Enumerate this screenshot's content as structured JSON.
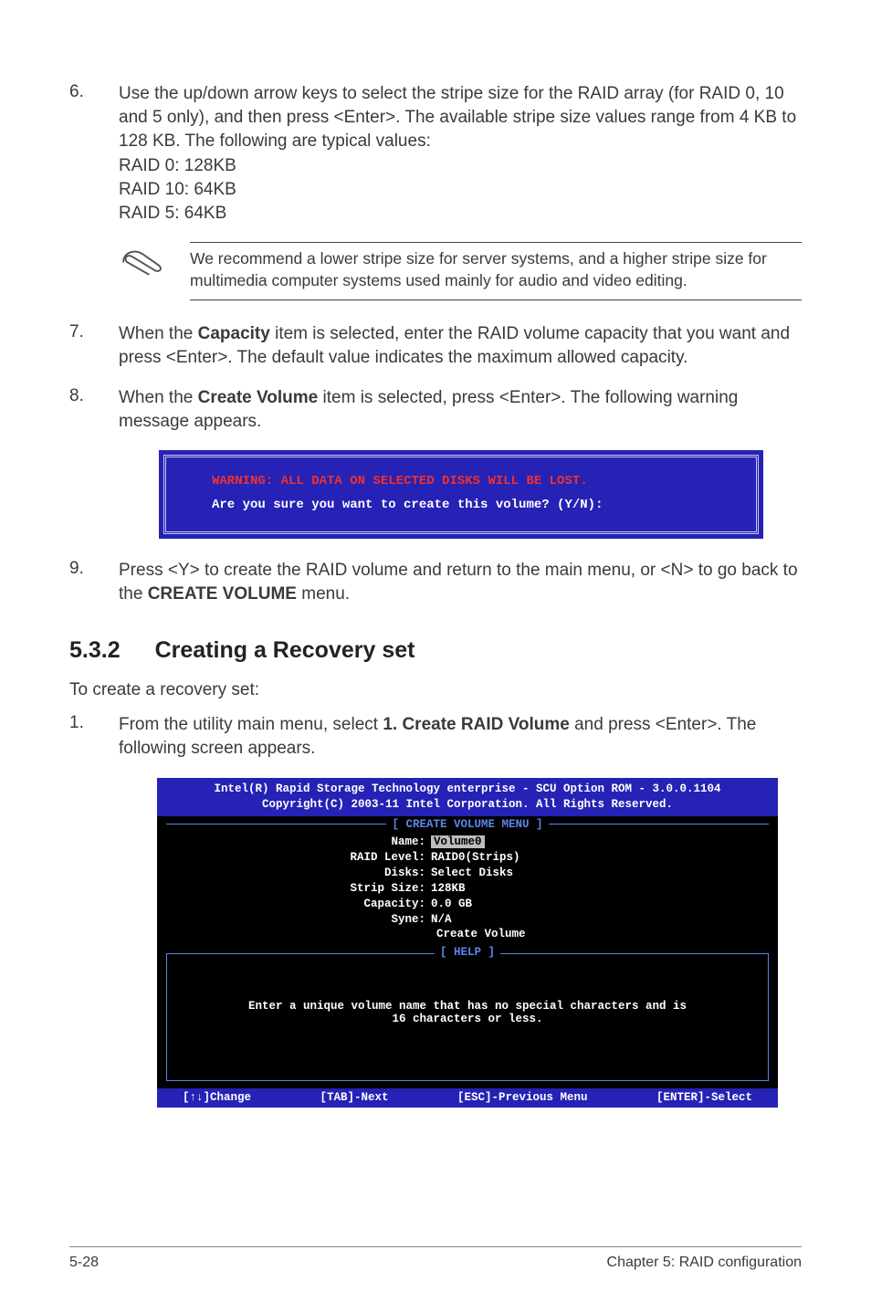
{
  "step6": {
    "num": "6.",
    "body": "Use the up/down arrow keys to select the stripe size for the RAID array (for RAID 0, 10 and 5 only), and then press <Enter>. The available stripe size values range from 4 KB to 128 KB. The following are typical values:",
    "l1": "RAID 0: 128KB",
    "l2": "RAID 10: 64KB",
    "l3": "RAID 5: 64KB"
  },
  "note1": "We recommend a lower stripe size for server systems, and a higher stripe size for multimedia computer systems used mainly for audio and video editing.",
  "step7": {
    "num": "7.",
    "pre": "When the ",
    "bold": "Capacity",
    "post": " item is selected, enter the RAID volume capacity that you want and press <Enter>. The default value indicates the maximum allowed capacity."
  },
  "step8": {
    "num": "8.",
    "pre": "When the ",
    "bold": "Create Volume",
    "post": " item is selected, press <Enter>. The following warning message appears."
  },
  "warn": {
    "red": "WARNING: ALL DATA ON SELECTED DISKS WILL BE LOST.",
    "white": "Are you sure you want to create this volume? (Y/N):"
  },
  "step9": {
    "num": "9.",
    "pre": "Press <Y> to create the RAID volume and return to the main menu, or <N> to go back to the ",
    "bold": "CREATE VOLUME",
    "post": " menu."
  },
  "h2": {
    "num": "5.3.2",
    "title": "Creating a Recovery set"
  },
  "intro": "To create a recovery set:",
  "step1b": {
    "num": "1.",
    "pre": "From the utility main menu, select ",
    "bold": "1. Create RAID Volume",
    "post": " and press <Enter>. The following screen appears."
  },
  "bios": {
    "title1": "Intel(R) Rapid Storage Technology enterprise - SCU Option ROM - 3.0.0.1104",
    "title2": "Copyright(C) 2003-11 Intel Corporation.  All Rights Reserved.",
    "sec1": "[ CREATE VOLUME MENU ]",
    "fields": {
      "name_l": "Name:",
      "name_v": "Volume0",
      "raid_l": "RAID Level:",
      "raid_v": "RAID0(Strips)",
      "disks_l": "Disks:",
      "disks_v": "Select Disks",
      "strip_l": "Strip Size:",
      "strip_v": "128KB",
      "cap_l": "Capacity:",
      "cap_v": "0.0  GB",
      "syne_l": "Syne:",
      "syne_v": "N/A",
      "create": "Create Volume"
    },
    "help_lbl": "[ HELP ]",
    "help1": "Enter a unique volume name that has no special characters and is",
    "help2": "16 characters or less.",
    "foot": {
      "a": "[↑↓]Change",
      "b": "[TAB]-Next",
      "c": "[ESC]-Previous Menu",
      "d": "[ENTER]-Select"
    }
  },
  "footer": {
    "left": "5-28",
    "right": "Chapter 5: RAID configuration"
  }
}
